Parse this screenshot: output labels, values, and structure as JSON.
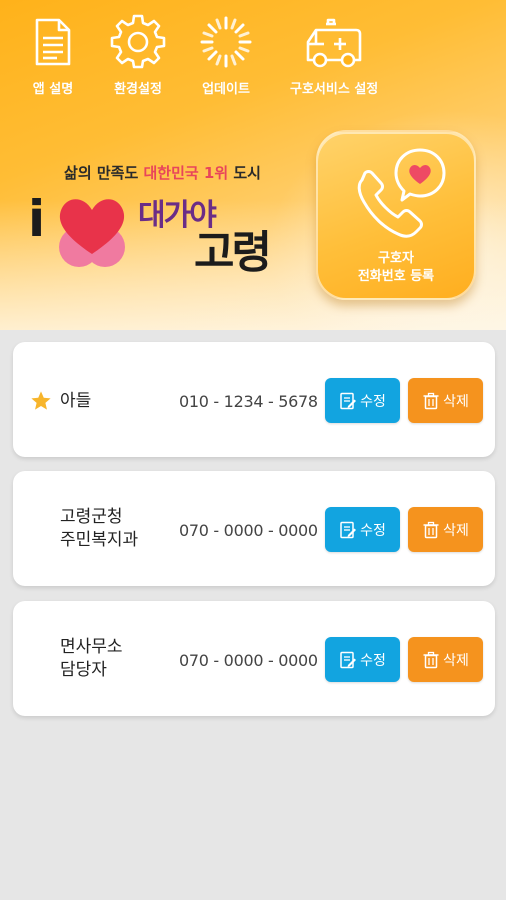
{
  "menu": [
    {
      "label": "앱 설명",
      "icon": "document-icon"
    },
    {
      "label": "환경설정",
      "icon": "gear-icon"
    },
    {
      "label": "업데이트",
      "icon": "loading-icon"
    },
    {
      "label": "구호서비스 설정",
      "icon": "ambulance-icon"
    }
  ],
  "banner": {
    "slogan_pre": "삶의 만족도 ",
    "slogan_highlight": "대한민국 1위",
    "slogan_post": " 도시",
    "logo_i": "i",
    "logo_word1": "대가야",
    "logo_word2": "고령"
  },
  "register": {
    "line1": "구호자",
    "line2": "전화번호 등록",
    "icon": "phone-heart-icon"
  },
  "contacts": [
    {
      "name_line1": "아들",
      "name_line2": "",
      "phone": "010 - 1234 - 5678",
      "favorite": true
    },
    {
      "name_line1": "고령군청",
      "name_line2": "주민복지과",
      "phone": "070 - 0000 - 0000",
      "favorite": false
    },
    {
      "name_line1": "면사무소",
      "name_line2": "담당자",
      "phone": "070 - 0000 - 0000",
      "favorite": false
    }
  ],
  "buttons": {
    "edit_label": "수정",
    "delete_label": "삭제"
  },
  "colors": {
    "header_orange": "#ffb21a",
    "edit_blue": "#12a4e0",
    "delete_orange": "#f5931e",
    "star_yellow": "#f7b52c",
    "logo_red": "#e8334a",
    "logo_pink": "#f07aa0",
    "logo_purple": "#6b2d87",
    "logo_text": "#1c1c1c"
  }
}
